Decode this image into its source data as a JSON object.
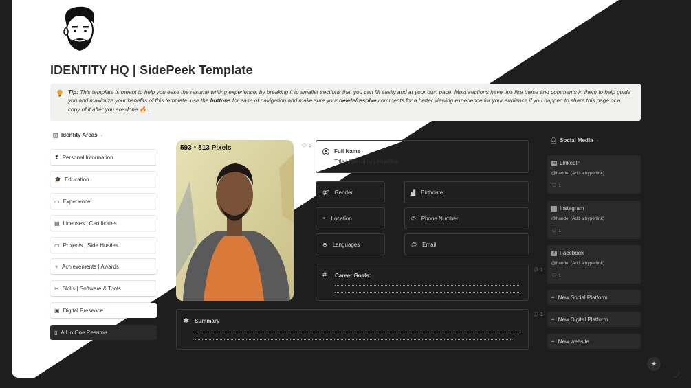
{
  "page": {
    "title": "IDENTITY HQ | SidePeek Template"
  },
  "tip": {
    "label": "Tip:",
    "text_part1": " This template is meant to help you ease the resume writing experience, by breaking it to smaller sections that you can fill easily and at your own pace. Most sections have tips like these and comments in them to help guide you and maximize your benefits of this template. use the ",
    "buttons_word": "buttons",
    "text_part2": " for ease of navigation and make sure your ",
    "delete_word": "delete/resolve",
    "text_part3": " comments for a better viewing experience for your audience if you happen to share this page or a copy of it after you are done ",
    "emoji": "🔥",
    "end": " ."
  },
  "nav": {
    "header": "Identity Areas",
    "items": [
      {
        "label": "Personal Information",
        "icon": "pin-icon"
      },
      {
        "label": "Education",
        "icon": "graduation-cap-icon"
      },
      {
        "label": "Experience",
        "icon": "briefcase-icon"
      },
      {
        "label": "Licenses | Certificates",
        "icon": "certificate-icon"
      },
      {
        "label": "Projects | Side Hustles",
        "icon": "briefcase-icon"
      },
      {
        "label": "Achievements | Awards",
        "icon": "trophy-icon"
      },
      {
        "label": "Skills | Software & Tools",
        "icon": "tools-icon"
      },
      {
        "label": "Digital Presence",
        "icon": "window-icon"
      },
      {
        "label": "All In One Resume",
        "icon": "document-icon"
      }
    ]
  },
  "photo": {
    "label": "593 * 813 Pixels",
    "comment_count": "1"
  },
  "profile": {
    "full_name_label": "Full Name",
    "full_name_value": "Title | Speciality | Headline",
    "gender": "Gender",
    "birthdate": "Birthdate",
    "location": "Location",
    "phone": "Phone Number",
    "languages": "Languages",
    "email": "Email",
    "career_goals": "Career Goals:",
    "career_comment_count": "1",
    "summary": "Summary",
    "summary_comment_count": "1"
  },
  "social": {
    "header": "Social Media",
    "items": [
      {
        "name": "LinkedIn",
        "handle": "@handel (Add a hyperlink)",
        "comments": "1",
        "badge": "in"
      },
      {
        "name": "Instagram",
        "handle": "@handel (Add a hyperlink)",
        "comments": "1",
        "badge": ""
      },
      {
        "name": "Facebook",
        "handle": "@handel (Add a hyperlink)",
        "comments": "1",
        "badge": "f"
      }
    ],
    "buttons": [
      {
        "label": "New Social Platform"
      },
      {
        "label": "New Digital Platform"
      },
      {
        "label": "New website"
      }
    ]
  }
}
